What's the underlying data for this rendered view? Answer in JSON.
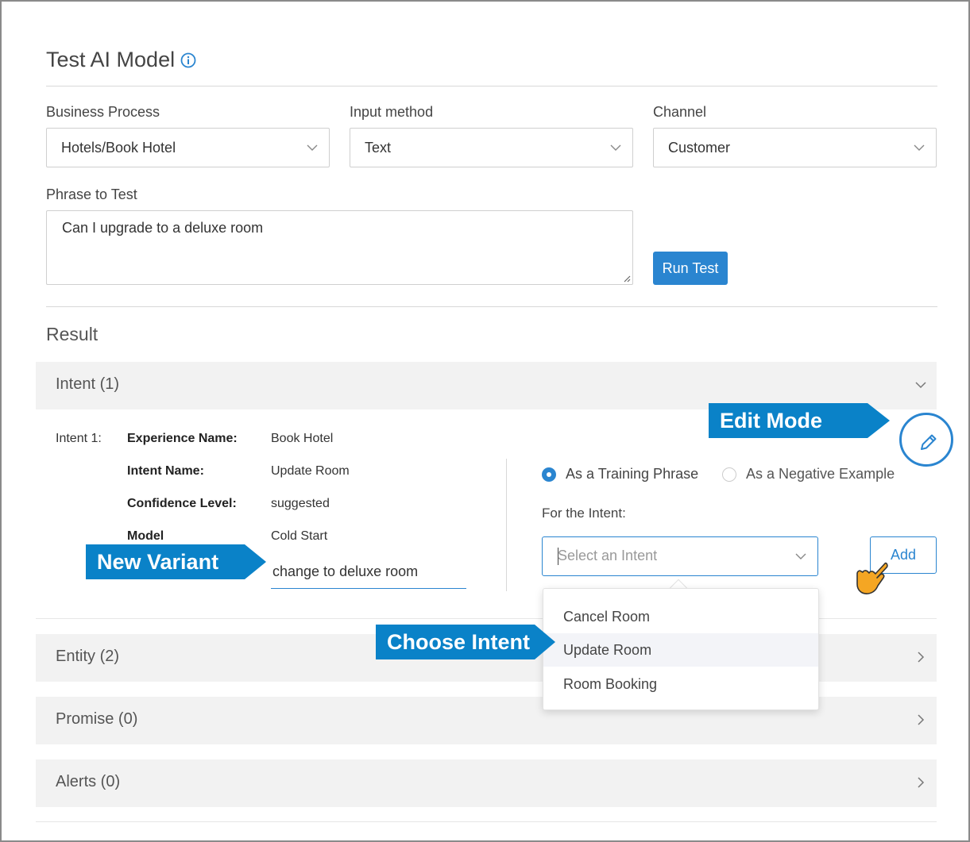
{
  "page": {
    "title": "Test AI Model"
  },
  "form": {
    "business_process_label": "Business Process",
    "business_process_value": "Hotels/Book Hotel",
    "input_method_label": "Input method",
    "input_method_value": "Text",
    "channel_label": "Channel",
    "channel_value": "Customer",
    "phrase_label": "Phrase to Test",
    "phrase_value": "Can I upgrade to a deluxe room",
    "run_button": "Run Test"
  },
  "result": {
    "title": "Result",
    "sections": [
      {
        "label": "Intent (1)",
        "expanded": true
      },
      {
        "label": "Entity (2)",
        "expanded": false
      },
      {
        "label": "Promise (0)",
        "expanded": false
      },
      {
        "label": "Alerts (0)",
        "expanded": false
      }
    ],
    "intent": {
      "prefix": "Intent 1:",
      "experience_name_label": "Experience Name:",
      "experience_name": "Book Hotel",
      "intent_name_label": "Intent Name:",
      "intent_name": "Update Room",
      "confidence_label": "Confidence Level:",
      "confidence": "suggested",
      "model_label": "Model",
      "model": "Cold Start",
      "variant_value": "change to deluxe room"
    },
    "training": {
      "option_training": "As a Training Phrase",
      "option_negative": "As a Negative Example",
      "selected": "training",
      "for_intent_label": "For the Intent:",
      "select_placeholder": "Select an Intent",
      "add_button": "Add",
      "dropdown_options": [
        "Cancel Room",
        "Update Room",
        "Room Booking"
      ],
      "highlighted_option": "Update Room"
    }
  },
  "annotations": {
    "edit_mode": "Edit Mode",
    "new_variant": "New Variant",
    "choose_intent": "Choose Intent",
    "color": "#0a82c8"
  },
  "colors": {
    "accent": "#2a85d0",
    "panel": "#f2f2f2"
  }
}
